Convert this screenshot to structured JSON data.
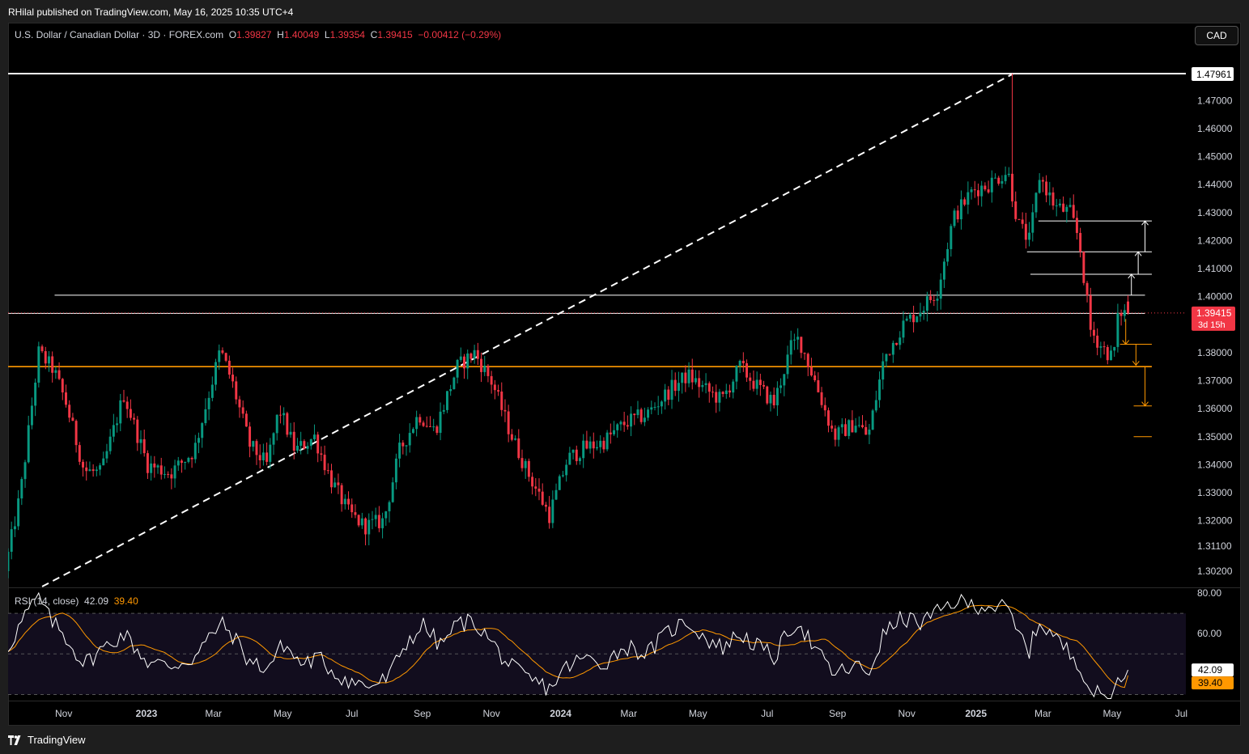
{
  "header": {
    "publisher": "RHilal published on TradingView.com, May 16, 2025 10:35 UTC+4"
  },
  "legend": {
    "symbol": "U.S. Dollar / Canadian Dollar · 3D · FOREX.com",
    "open_label": "O",
    "open": "1.39827",
    "high_label": "H",
    "high": "1.40049",
    "low_label": "L",
    "low": "1.39354",
    "close_label": "C",
    "close": "1.39415",
    "change": "−0.00412 (−0.29%)"
  },
  "currency_button": "CAD",
  "price_axis": {
    "ticks": [
      "1.47000",
      "1.46000",
      "1.45000",
      "1.44000",
      "1.43000",
      "1.42000",
      "1.41000",
      "1.40000",
      "1.39000",
      "1.38000",
      "1.37000",
      "1.36000",
      "1.35000",
      "1.34000",
      "1.33000",
      "1.32000",
      "1.31100",
      "1.30200"
    ],
    "high_tag": "1.47961",
    "last_tag": "1.39415",
    "countdown": "3d 15h"
  },
  "time_axis": {
    "labels": [
      "Nov",
      "2023",
      "Mar",
      "May",
      "Jul",
      "Sep",
      "Nov",
      "2024",
      "Mar",
      "May",
      "Jul",
      "Sep",
      "Nov",
      "2025",
      "Mar",
      "May",
      "Jul"
    ]
  },
  "rsi": {
    "title": "RSI (14, close)",
    "value": "42.09",
    "ma_value": "39.40",
    "ticks": [
      "80.00",
      "60.00"
    ]
  },
  "footer": {
    "brand": "TradingView"
  },
  "colors": {
    "up": "#089981",
    "down": "#f23645",
    "support": "#ff9800",
    "rsi_line": "#ffffff",
    "rsi_ma": "#ff9800",
    "background": "#000000"
  },
  "chart_data": {
    "type": "candlestick",
    "title": "U.S. Dollar / Canadian Dollar · 3D · FOREX.com",
    "timeframe": "3D",
    "ylim": [
      1.297,
      1.483
    ],
    "x_range": [
      "2022-09-01",
      "2025-07-05"
    ],
    "anchors": [
      [
        "2022-09-01",
        1.302
      ],
      [
        "2022-09-15",
        1.33
      ],
      [
        "2022-10-01",
        1.38
      ],
      [
        "2022-10-14",
        1.374
      ],
      [
        "2022-10-25",
        1.362
      ],
      [
        "2022-11-10",
        1.338
      ],
      [
        "2022-11-25",
        1.337
      ],
      [
        "2022-12-15",
        1.365
      ],
      [
        "2023-01-05",
        1.34
      ],
      [
        "2023-01-25",
        1.337
      ],
      [
        "2023-02-15",
        1.345
      ],
      [
        "2023-03-10",
        1.381
      ],
      [
        "2023-03-20",
        1.37
      ],
      [
        "2023-04-05",
        1.347
      ],
      [
        "2023-04-20",
        1.34
      ],
      [
        "2023-05-01",
        1.36
      ],
      [
        "2023-05-15",
        1.345
      ],
      [
        "2023-06-01",
        1.35
      ],
      [
        "2023-06-15",
        1.335
      ],
      [
        "2023-07-01",
        1.323
      ],
      [
        "2023-07-15",
        1.318
      ],
      [
        "2023-08-01",
        1.32
      ],
      [
        "2023-08-15",
        1.345
      ],
      [
        "2023-09-01",
        1.358
      ],
      [
        "2023-09-15",
        1.352
      ],
      [
        "2023-10-05",
        1.375
      ],
      [
        "2023-10-20",
        1.38
      ],
      [
        "2023-11-05",
        1.369
      ],
      [
        "2023-11-20",
        1.352
      ],
      [
        "2023-12-05",
        1.338
      ],
      [
        "2023-12-25",
        1.322
      ],
      [
        "2024-01-10",
        1.342
      ],
      [
        "2024-01-25",
        1.346
      ],
      [
        "2024-02-10",
        1.348
      ],
      [
        "2024-03-01",
        1.355
      ],
      [
        "2024-03-20",
        1.358
      ],
      [
        "2024-04-10",
        1.367
      ],
      [
        "2024-04-25",
        1.372
      ],
      [
        "2024-05-10",
        1.367
      ],
      [
        "2024-05-25",
        1.363
      ],
      [
        "2024-06-10",
        1.375
      ],
      [
        "2024-06-25",
        1.368
      ],
      [
        "2024-07-10",
        1.362
      ],
      [
        "2024-07-25",
        1.382
      ],
      [
        "2024-08-01",
        1.385
      ],
      [
        "2024-08-15",
        1.37
      ],
      [
        "2024-09-01",
        1.35
      ],
      [
        "2024-09-20",
        1.355
      ],
      [
        "2024-10-01",
        1.35
      ],
      [
        "2024-10-15",
        1.378
      ],
      [
        "2024-11-01",
        1.39
      ],
      [
        "2024-11-15",
        1.395
      ],
      [
        "2024-12-01",
        1.402
      ],
      [
        "2024-12-15",
        1.428
      ],
      [
        "2025-01-01",
        1.438
      ],
      [
        "2025-01-15",
        1.44
      ],
      [
        "2025-02-01",
        1.445
      ],
      [
        "2025-02-10",
        1.426
      ],
      [
        "2025-02-20",
        1.42
      ],
      [
        "2025-03-01",
        1.443
      ],
      [
        "2025-03-15",
        1.432
      ],
      [
        "2025-03-28",
        1.43
      ],
      [
        "2025-04-05",
        1.42
      ],
      [
        "2025-04-15",
        1.388
      ],
      [
        "2025-04-25",
        1.382
      ],
      [
        "2025-05-05",
        1.378
      ],
      [
        "2025-05-10",
        1.395
      ],
      [
        "2025-05-16",
        1.394
      ]
    ],
    "last_candle": {
      "open": 1.39827,
      "high": 1.40049,
      "low": 1.39354,
      "close": 1.39415
    },
    "swing_high": {
      "date": "2025-02-03",
      "value": 1.47961
    },
    "levels": [
      {
        "value": 1.47961,
        "color": "#ffffff",
        "from": "2022-09-01",
        "to": "2025-07-05"
      },
      {
        "value": 1.4005,
        "color": "#ffffff",
        "from": "2022-10-12",
        "to": "2025-05-30"
      },
      {
        "value": 1.394,
        "color": "#ffffff",
        "from": "2022-09-01",
        "to": "2025-05-30"
      },
      {
        "value": 1.375,
        "color": "#ff9800",
        "from": "2022-09-01",
        "to": "2025-06-05"
      },
      {
        "value": 1.427,
        "color": "#ffffff",
        "from": "2025-02-25",
        "to": "2025-06-05"
      },
      {
        "value": 1.416,
        "color": "#ffffff",
        "from": "2025-02-15",
        "to": "2025-06-05"
      },
      {
        "value": 1.408,
        "color": "#ffffff",
        "from": "2025-02-18",
        "to": "2025-06-05"
      },
      {
        "value": 1.383,
        "color": "#ff9800",
        "from": "2025-05-08",
        "to": "2025-06-05"
      },
      {
        "value": 1.361,
        "color": "#ff9800",
        "from": "2025-05-20",
        "to": "2025-06-05"
      },
      {
        "value": 1.35,
        "color": "#ff9800",
        "from": "2025-05-20",
        "to": "2025-06-05"
      }
    ],
    "trendline": {
      "from": [
        "2022-10-01",
        1.2965
      ],
      "to": [
        "2025-02-03",
        1.47961
      ],
      "style": "dashed",
      "color": "#ffffff"
    },
    "arrows": [
      {
        "date": "2025-05-18",
        "from": 1.4005,
        "to": 1.408,
        "color": "#ffffff"
      },
      {
        "date": "2025-05-24",
        "from": 1.408,
        "to": 1.416,
        "color": "#ffffff"
      },
      {
        "date": "2025-05-30",
        "from": 1.416,
        "to": 1.427,
        "color": "#ffffff"
      },
      {
        "date": "2025-05-13",
        "from": 1.392,
        "to": 1.383,
        "color": "#ff9800"
      },
      {
        "date": "2025-05-22",
        "from": 1.383,
        "to": 1.3755,
        "color": "#ff9800"
      },
      {
        "date": "2025-05-30",
        "from": 1.375,
        "to": 1.361,
        "color": "#ff9800"
      }
    ],
    "rsi": {
      "period": 14,
      "ylim": [
        27,
        82
      ],
      "levels": [
        70,
        50,
        30
      ],
      "last": 42.09,
      "ma_last": 39.4,
      "anchors": [
        [
          "2022-09-01",
          50
        ],
        [
          "2022-09-20",
          70
        ],
        [
          "2022-10-01",
          78
        ],
        [
          "2022-10-10",
          68
        ],
        [
          "2022-10-25",
          58
        ],
        [
          "2022-11-10",
          45
        ],
        [
          "2022-11-25",
          52
        ],
        [
          "2022-12-15",
          60
        ],
        [
          "2023-01-05",
          46
        ],
        [
          "2023-01-25",
          44
        ],
        [
          "2023-02-15",
          48
        ],
        [
          "2023-03-10",
          65
        ],
        [
          "2023-03-20",
          60
        ],
        [
          "2023-04-05",
          46
        ],
        [
          "2023-04-20",
          43
        ],
        [
          "2023-05-05",
          55
        ],
        [
          "2023-05-20",
          45
        ],
        [
          "2023-06-05",
          48
        ],
        [
          "2023-06-20",
          40
        ],
        [
          "2023-07-05",
          36
        ],
        [
          "2023-07-20",
          34
        ],
        [
          "2023-08-05",
          38
        ],
        [
          "2023-08-20",
          55
        ],
        [
          "2023-09-05",
          64
        ],
        [
          "2023-09-20",
          54
        ],
        [
          "2023-10-05",
          65
        ],
        [
          "2023-10-20",
          66
        ],
        [
          "2023-11-05",
          55
        ],
        [
          "2023-11-20",
          44
        ],
        [
          "2023-12-05",
          38
        ],
        [
          "2023-12-25",
          33
        ],
        [
          "2024-01-10",
          44
        ],
        [
          "2024-01-25",
          48
        ],
        [
          "2024-02-10",
          45
        ],
        [
          "2024-03-01",
          54
        ],
        [
          "2024-03-20",
          50
        ],
        [
          "2024-04-10",
          62
        ],
        [
          "2024-04-25",
          66
        ],
        [
          "2024-05-10",
          58
        ],
        [
          "2024-05-25",
          53
        ],
        [
          "2024-06-10",
          60
        ],
        [
          "2024-06-25",
          54
        ],
        [
          "2024-07-10",
          48
        ],
        [
          "2024-07-25",
          63
        ],
        [
          "2024-08-01",
          66
        ],
        [
          "2024-08-15",
          52
        ],
        [
          "2024-09-01",
          40
        ],
        [
          "2024-09-20",
          44
        ],
        [
          "2024-10-01",
          40
        ],
        [
          "2024-10-15",
          60
        ],
        [
          "2024-11-01",
          68
        ],
        [
          "2024-11-15",
          65
        ],
        [
          "2024-12-01",
          70
        ],
        [
          "2024-12-15",
          76
        ],
        [
          "2025-01-01",
          74
        ],
        [
          "2025-01-15",
          74
        ],
        [
          "2025-02-01",
          72
        ],
        [
          "2025-02-10",
          60
        ],
        [
          "2025-02-20",
          52
        ],
        [
          "2025-03-01",
          66
        ],
        [
          "2025-03-15",
          58
        ],
        [
          "2025-03-28",
          50
        ],
        [
          "2025-04-05",
          46
        ],
        [
          "2025-04-15",
          32
        ],
        [
          "2025-04-25",
          29
        ],
        [
          "2025-05-05",
          29
        ],
        [
          "2025-05-10",
          40
        ],
        [
          "2025-05-16",
          42.09
        ]
      ]
    }
  }
}
